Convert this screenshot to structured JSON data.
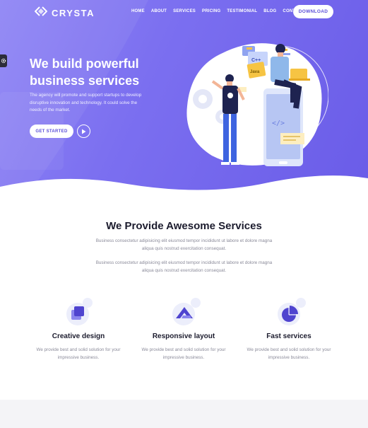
{
  "brand": {
    "name": "CRYSTA"
  },
  "nav": {
    "items": [
      "HOME",
      "ABOUT",
      "SERVICES",
      "PRICING",
      "TESTIMONIAL",
      "BLOG",
      "CONTACT"
    ],
    "download_label": "DOWNLOAD"
  },
  "hero": {
    "title": "We build powerful business services",
    "description": "The agency will promote and support startups to develop disruptive innovation and technology. It could solve the needs of the market.",
    "cta_label": "GET STARTED",
    "illustration_labels": {
      "cpp": "C++",
      "java": "Java"
    }
  },
  "services": {
    "title": "We Provide Awesome Services",
    "paragraph_1": "Business consectetur adipisicing elit eiusmod tempor incididunt ut labore et dolore magna aliqua quis nostrud exercitation consequat.",
    "paragraph_2": "Business consectetur adipisicing elit eiusmod tempor incididunt ut labore et dolore magna aliqua quis nostrud exercitation consequat.",
    "features": [
      {
        "title": "Creative design",
        "text": "We provide best and solid solution for your impressive business.",
        "icon": "layers-icon"
      },
      {
        "title": "Responsive layout",
        "text": "We provide best and solid solution for your impressive business.",
        "icon": "responsive-icon"
      },
      {
        "title": "Fast services",
        "text": "We provide best and solid solution for your impressive business.",
        "icon": "pie-chart-icon"
      }
    ]
  },
  "colors": {
    "accent": "#6a5ce8",
    "hero_light": "#8f85f5",
    "text_dark": "#1c1c2e",
    "text_muted": "#8a8a99"
  }
}
